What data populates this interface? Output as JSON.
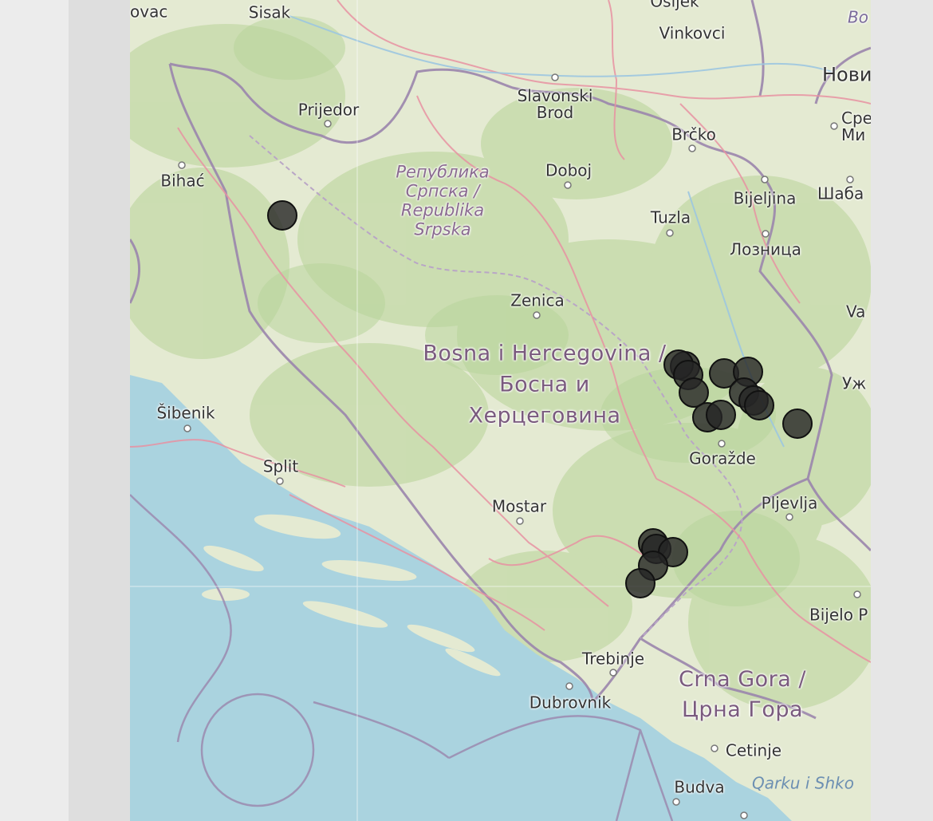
{
  "map": {
    "cities": [
      {
        "name": "ovac"
      },
      {
        "name": "Sisak"
      },
      {
        "name": "Osijek"
      },
      {
        "name": "Vinkovci"
      },
      {
        "name": "Bo"
      },
      {
        "name": "Нови"
      },
      {
        "name": "Prijedor"
      },
      {
        "name": "Slavonski\nBrod"
      },
      {
        "name": "Brčko"
      },
      {
        "name": "Срем\nМи"
      },
      {
        "name": "Bihać"
      },
      {
        "name": "Doboj"
      },
      {
        "name": "Bijeljina"
      },
      {
        "name": "Шаба"
      },
      {
        "name": "Tuzla"
      },
      {
        "name": "Лозница"
      },
      {
        "name": "Zenica"
      },
      {
        "name": "Va"
      },
      {
        "name": "Уж"
      },
      {
        "name": "Šibenik"
      },
      {
        "name": "Goražde"
      },
      {
        "name": "Split"
      },
      {
        "name": "Mostar"
      },
      {
        "name": "Pljevlja"
      },
      {
        "name": "Bijelo P"
      },
      {
        "name": "Trebinje"
      },
      {
        "name": "Dubrovnik"
      },
      {
        "name": "Cetinje"
      },
      {
        "name": "Budva"
      }
    ],
    "regions": [
      {
        "name": "Република\nСрпска /\nRepublika\nSrpska"
      },
      {
        "name": "Bosna i Hercegovina /\nБосна и\nХерцеговина"
      },
      {
        "name": "Crna Gora /\nЦрна Гора"
      }
    ],
    "water": [
      {
        "name": "Qarku i Shko"
      }
    ],
    "marker_color": "#2a2a2a",
    "marker_count": 24
  }
}
